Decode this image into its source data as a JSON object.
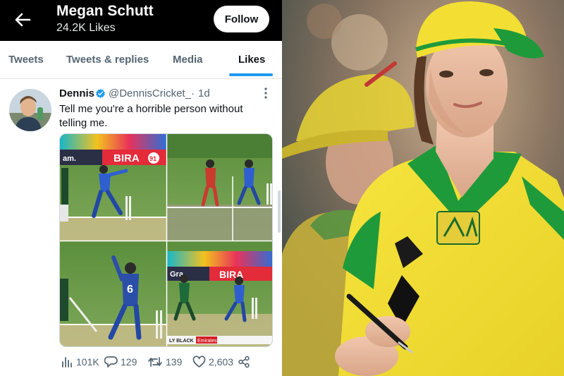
{
  "profile": {
    "name": "Megan Schutt",
    "likes": "24.2K Likes",
    "follow_label": "Follow"
  },
  "tabs": [
    {
      "label": "Tweets",
      "active": false
    },
    {
      "label": "Tweets & replies",
      "active": false
    },
    {
      "label": "Media",
      "active": false
    },
    {
      "label": "Likes",
      "active": true
    }
  ],
  "tweet": {
    "author_name": "Dennis",
    "handle": "@DennisCricket_",
    "separator": "·",
    "time": "1d",
    "text": "Tell me you're a horrible person without telling me.",
    "media_banner_text": "BIRA",
    "media_banner_number": "91",
    "media_corner_text_top": "am.",
    "media_corner_text_mid": "Gra.",
    "media_player_number": "6",
    "media_ticker_text": "LY BLACK",
    "media_ticker_brand": "Emirates",
    "stats": {
      "views": "101K",
      "replies": "129",
      "retweets": "139",
      "likes": "2,603"
    }
  },
  "colors": {
    "twitter_blue": "#1d9bf0",
    "topbar": "#000000",
    "muted_text": "#536471",
    "aus_yellow": "#f4e23a",
    "aus_green": "#1f9a3a"
  },
  "icons": {
    "back": "arrow-left-icon",
    "verified": "verified-badge-icon",
    "more": "more-vertical-icon",
    "views": "bar-chart-icon",
    "reply": "speech-bubble-icon",
    "retweet": "retweet-arrows-icon",
    "like": "heart-icon",
    "share": "share-icon"
  }
}
